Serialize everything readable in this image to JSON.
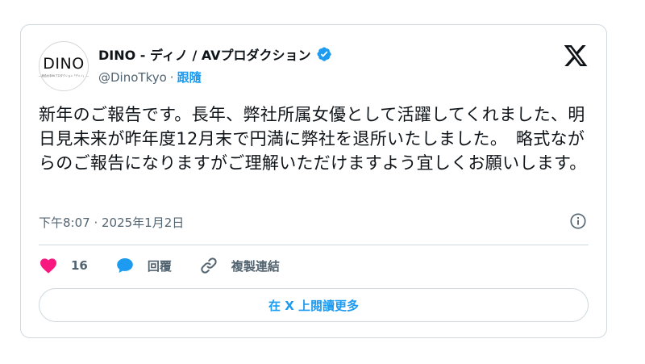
{
  "author": {
    "avatar_logo": "DINO",
    "avatar_sub": "— 総合大手AVプロダクション「ディノ」 —",
    "display_name": "DINO - ディノ / AVプロダクション",
    "handle": "@DinoTkyo",
    "separator": "·",
    "follow_label": "跟隨",
    "verified_icon": "verified-badge-icon"
  },
  "tweet": {
    "text": "新年のご報告です。長年、弊社所属女優として活躍してくれました、明日見未来が昨年度12月末で円満に弊社を退所いたしました。　略式ながらのご報告になりますがご理解いただけますよう宜しくお願いします。",
    "timestamp": "下午8:07 · 2025年1月2日"
  },
  "actions": {
    "like_count": "16",
    "reply_label": "回覆",
    "copy_link_label": "複製連結"
  },
  "footer": {
    "read_more_label": "在 X 上閱讀更多"
  },
  "colors": {
    "accent": "#1d9bf0",
    "like": "#f91880",
    "text": "#0f1419",
    "muted": "#536471",
    "border": "#cfd9de"
  }
}
